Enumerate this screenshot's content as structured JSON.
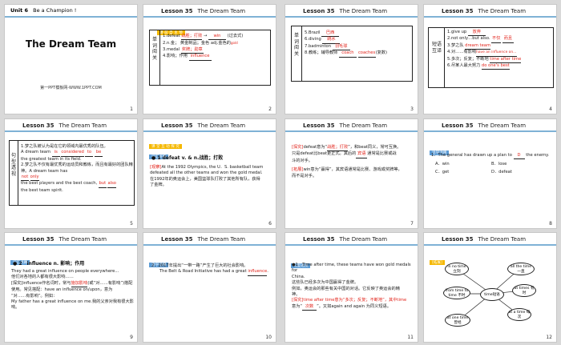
{
  "lesson_label": "Lesson 35",
  "lesson_title": "The Dream Team",
  "slides": [
    {
      "id": 1,
      "unit_label": "Unit 6",
      "unit_title": "Be a Champion !",
      "title": "The Dream Team",
      "footer": "第一PPT模板网-WWW.1PPT.COM",
      "number": "1"
    },
    {
      "id": 2,
      "tag": "课 前 自 主 预",
      "side": "单词阅关",
      "items": [
        "1.defeat",
        "2.n.金； 黄金制品；金色 adj.金色的",
        "3.medal",
        "4.影响；作用"
      ],
      "answers": [
        "战胜；打败",
        "win",
        "(过去式)",
        "gold",
        "奖牌；勋章",
        "influence"
      ],
      "number": "2"
    },
    {
      "id": 3,
      "side": "单词阅关",
      "items": [
        "5.Brazil",
        "6.diving",
        "7.badminton",
        "8.教练；辅导教师"
      ],
      "answers": [
        "巴西",
        "跳水",
        "羽毛球",
        "coach",
        "coaches",
        "(复数)"
      ],
      "number": "3"
    },
    {
      "id": 4,
      "side": "短语互译",
      "items": [
        "1.give up",
        "2.not only…but also.",
        "3.梦之队",
        "4.对……有影响",
        "5.多次；反复；不断地",
        "6.尽某人最大努力"
      ],
      "answers": [
        "放弃",
        "不仅",
        "而且",
        "dream team",
        "have an influence on…",
        "time after time",
        "do one's best"
      ],
      "number": "4"
    },
    {
      "id": 5,
      "side": "句型透视",
      "lines": [
        "1.梦之队被认为是在它的领域内最优秀的队伍。",
        "A dream team",
        "is",
        "considered",
        "to",
        "be",
        "the greatest team in its field.",
        "2.梦之队不仅有最优秀的运动员和教练，而且有最好的团队精神。A dream team has",
        "not",
        "only",
        "the best players and the best coach,",
        "but",
        "also",
        "the best team spirit."
      ],
      "number": "5"
    },
    {
      "id": 6,
      "tag": "课 堂 互 动 探 究",
      "sub_tag": "词汇点睛",
      "heading": "defeat v. & n.战胜；打败",
      "label": "[观察]",
      "lines": [
        "At the 1992 Olympics, the U．S. basketball team",
        "defeated all the other teams and won the gold medal.",
        "在1992年的奥运会上，美国篮球队打败了其他所有队，获得",
        "了金牌。"
      ],
      "number": "6"
    },
    {
      "id": 7,
      "label1": "[探究]",
      "label2": "[拓展]",
      "lines": [
        "defeat意为“",
        "战胜；打败",
        "”，和beat同义，常可互换。",
        "只是defeat比beat更正式。其后的",
        "宾语",
        "通常是比赛或战",
        "斗的对手。",
        "win意为“赢得”，其宾语通常是比赛、游戏或奖牌等，",
        "而不是对手。"
      ],
      "number": "7"
    },
    {
      "id": 8,
      "sub_tag": "活学活用",
      "question": "1．The general has drawn up a plan to",
      "after": "the enemy.",
      "answer": "D",
      "options": [
        "A．win",
        "B．lose",
        "C．get",
        "D．defeat"
      ],
      "number": "8"
    },
    {
      "id": 9,
      "sub_tag": "词汇点睛",
      "heading": "2　influence n. 影响；作用",
      "lines": [
        "They had a great influence on people everywhere...",
        "他们对各地的人都有很大影响……",
        "[探究]influence作名词时，常与",
        "施加影响",
        "(或“对……有影响”)搭配使用。常见搭配：have an influence on/upon，意为",
        "“对……有影响”。例如：",
        "My father has a great influence on me.我的父亲对我有很大影",
        "响。"
      ],
      "number": "9"
    },
    {
      "id": 10,
      "sub_tag": "活学活用",
      "lines": [
        "2．2017年提出“一带一路”产生了巨大的社会影响。",
        "The Belt & Road Initiative has had a great",
        "influence",
        "."
      ],
      "number": "10"
    },
    {
      "id": 11,
      "sub_tag": "句型透视",
      "lines": [
        "●1　Time after time, these teams have won gold medals for",
        "China.",
        "这些队已经多次为中国赢得了金牌。",
        "例如，奥运会的那些有关中国的对话。它反映了奥运会的精",
        "神。",
        "[探究]time after time意为“多次；反复；不断地”，其中time",
        "意为“",
        "次数",
        "”。又如again and again 为同义短语。"
      ],
      "number": "11"
    },
    {
      "id": 12,
      "sub_tag": "[拓展]",
      "center": "time短语",
      "bubbles": [
        "in no time 立刻",
        "all the time 一直",
        "from time to time 不时",
        "at times 有时",
        "at one time 曾经",
        "at a time 每次"
      ],
      "number": "12"
    }
  ]
}
